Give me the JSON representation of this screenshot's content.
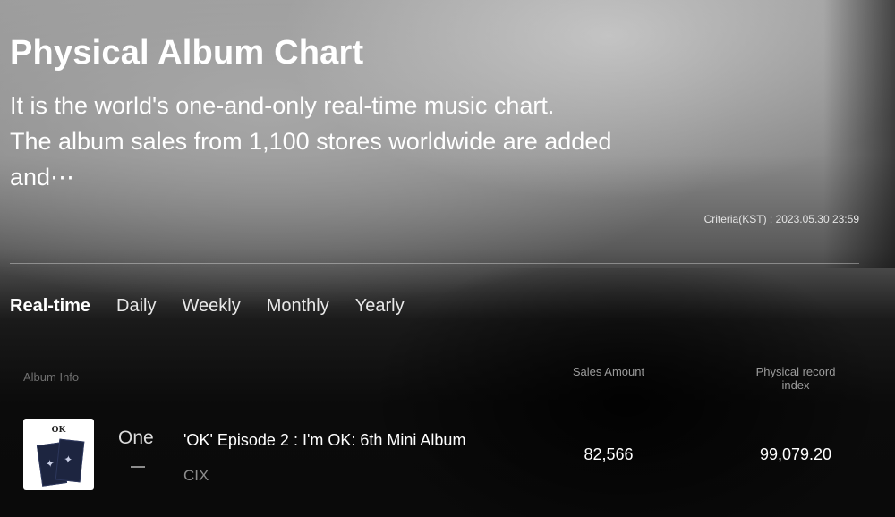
{
  "header": {
    "title": "Physical Album Chart",
    "description_line1": "It is the world's one-and-only real-time music chart.",
    "description_line2": "The album sales from 1,100 stores worldwide are added and⋯",
    "criteria": "Criteria(KST) : 2023.05.30 23:59"
  },
  "tabs": [
    {
      "label": "Real-time",
      "active": true
    },
    {
      "label": "Daily",
      "active": false
    },
    {
      "label": "Weekly",
      "active": false
    },
    {
      "label": "Monthly",
      "active": false
    },
    {
      "label": "Yearly",
      "active": false
    }
  ],
  "table": {
    "headers": {
      "album_info": "Album Info",
      "sales_amount": "Sales Amount",
      "physical_index": "Physical record index"
    },
    "rows": [
      {
        "rank": "One",
        "rank_change": "—",
        "album": "'OK' Episode 2 : I'm OK: 6th Mini Album",
        "artist": "CIX",
        "sales": "82,566",
        "index": "99,079.20",
        "cover_text": "OK",
        "cover_icon": "album-cover-icon"
      }
    ]
  },
  "colors": {
    "background": "#0b0b0b",
    "text_primary": "#ffffff",
    "text_muted": "#8d8d8d"
  }
}
